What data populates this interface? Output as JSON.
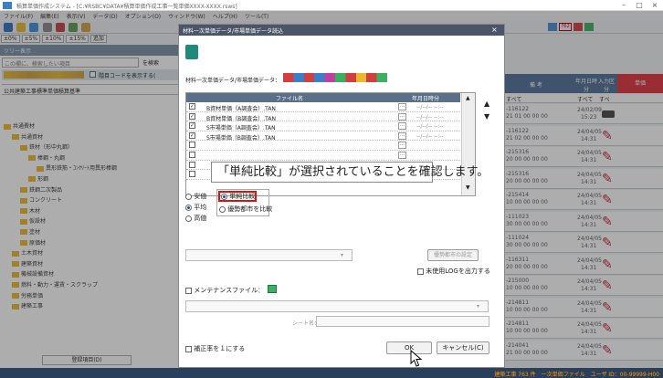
{
  "app": {
    "title": "積算単価作成システム - [C:¥RSBC¥DATA¥積算単価作成工事一覧単価XXXX-XXXX.rsws]",
    "menu": [
      "ファイル(F)",
      "編集(E)",
      "表示(V)",
      "データ(D)",
      "オプション(O)",
      "ウィンドウ(W)",
      "ヘルプ(H)",
      "ツール(T)"
    ],
    "toolbar_counter": "762",
    "rates": [
      "±0%",
      "±5%",
      "±10%",
      "±15%",
      "追加"
    ]
  },
  "left_panel": {
    "header": "ツリー表示",
    "search_placeholder": "この欄に、検索したい項目",
    "search_button": "を検索",
    "code_label": "階目コードを表示する(",
    "project_label": "公共建築工事標準単価積算基準",
    "tree": [
      {
        "label": "共通費材",
        "indent": 0
      },
      {
        "label": "共通資材",
        "indent": 1
      },
      {
        "label": "鉄材（形中丸鋼）",
        "indent": 2
      },
      {
        "label": "棒鋼・丸鋼",
        "indent": 3
      },
      {
        "label": "異形鉄筋・ｺﾝｸﾘｰﾄ用異形棒鋼",
        "indent": 4
      },
      {
        "label": "形鋼",
        "indent": 3
      },
      {
        "label": "鉄鋼二次製品",
        "indent": 2
      },
      {
        "label": "コンクリート",
        "indent": 2
      },
      {
        "label": "木材",
        "indent": 2
      },
      {
        "label": "仮設材",
        "indent": 2
      },
      {
        "label": "塗材",
        "indent": 2
      },
      {
        "label": "原価材",
        "indent": 2
      },
      {
        "label": "土木資材",
        "indent": 1
      },
      {
        "label": "建築資材",
        "indent": 1
      },
      {
        "label": "機械設備資材",
        "indent": 1
      },
      {
        "label": "燃料・動力・運賃・スクラップ",
        "indent": 1
      },
      {
        "label": "労務単価",
        "indent": 1
      },
      {
        "label": "建築工事",
        "indent": 1
      }
    ],
    "footer_button": "登録項目(D)"
  },
  "right_panel": {
    "columns": [
      "備 考",
      "年月日時分",
      "入力区分",
      "単価"
    ],
    "filters": [
      "すべて",
      "すべて",
      "すべ"
    ],
    "rows": [
      {
        "code": "-116122",
        "num": "21 01 00 00 00",
        "date": "24/02/09",
        "time": "15:23"
      },
      {
        "code": "-116122",
        "num": "21 02 00 00 00",
        "date": "24/04/05",
        "time": "14:31"
      },
      {
        "code": "-215316",
        "num": "20 00 00 00 00",
        "date": "24/04/05",
        "time": "14:31"
      },
      {
        "code": "-215316",
        "num": "20 00 00 00 00",
        "date": "24/04/05",
        "time": "14:31"
      },
      {
        "code": "-215414",
        "num": "10 00 00 00 00",
        "date": "24/04/05",
        "time": "14:31"
      },
      {
        "code": "-111023",
        "num": "30 00 00 00 00",
        "date": "24/04/05",
        "time": "14:31"
      },
      {
        "code": "-111024",
        "num": "30 00 00 00 00",
        "date": "24/04/05",
        "time": "14:31"
      },
      {
        "code": "-116311",
        "num": "20 00 00 00 00",
        "date": "24/04/05",
        "time": "14:31"
      },
      {
        "code": "-215000",
        "num": "10 00 00 00 00",
        "date": "24/04/05",
        "time": "14:31"
      },
      {
        "code": "-214811",
        "num": "10 00 00 00 00",
        "date": "24/04/05",
        "time": "14:31"
      },
      {
        "code": "-214811",
        "num": "10 00 00 00 00",
        "date": "24/04/05",
        "time": "14:31"
      },
      {
        "code": "-214041",
        "num": "21 00 00 00 00",
        "date": "24/04/05",
        "time": "14:31"
      }
    ]
  },
  "dialog": {
    "title": "材料一次単価データ/市場単価データ読込",
    "data_label": "材料一次単価データ/市場単価データ：",
    "file_col": "ファイル名",
    "date_col": "年月日時分",
    "files": [
      {
        "name": "B資材単価（A調査会）.TAN",
        "checked": true,
        "date": "--/--/-- --:--"
      },
      {
        "name": "B資材単価（B調査会）.TAN",
        "checked": true,
        "date": "--/--/-- --:--"
      },
      {
        "name": "S市場単価（A調査会）.TAN",
        "checked": true,
        "date": "--/--/-- --:--"
      },
      {
        "name": "S市場単価（B調査会）.TAN",
        "checked": true,
        "date": "--/--/-- --:--"
      },
      {
        "name": "",
        "checked": false,
        "date": ""
      },
      {
        "name": "",
        "checked": false,
        "date": ""
      },
      {
        "name": "",
        "checked": false,
        "date": ""
      },
      {
        "name": "",
        "checked": false,
        "date": ""
      }
    ],
    "radio_left": [
      "安値",
      "平均",
      "高値"
    ],
    "radio_right": [
      "単純比較",
      "優勢都市を比較"
    ],
    "selected_left": "平均",
    "selected_right": "単純比較",
    "settings_button": "優勢都市の設定",
    "unused_log_label": "未使用LOGを出力する",
    "maintenance_label": "メンテナンスファイル：",
    "sheet_label": "シート名：",
    "correction_label": "補正率を１にする",
    "ok_button": "OK",
    "cancel_button": "キャンセル(C)"
  },
  "callout": {
    "text": "「単純比較」が選択されていることを確認します。"
  },
  "status_bar": {
    "text": "建築工事 763 件　一次単価ファイル　ユーザ ID：00-99999-H00"
  },
  "colors": {
    "accent": "#4e6f96",
    "highlight": "#e01010",
    "dialog_title": "#4a5668",
    "status_text": "#ff9900"
  }
}
